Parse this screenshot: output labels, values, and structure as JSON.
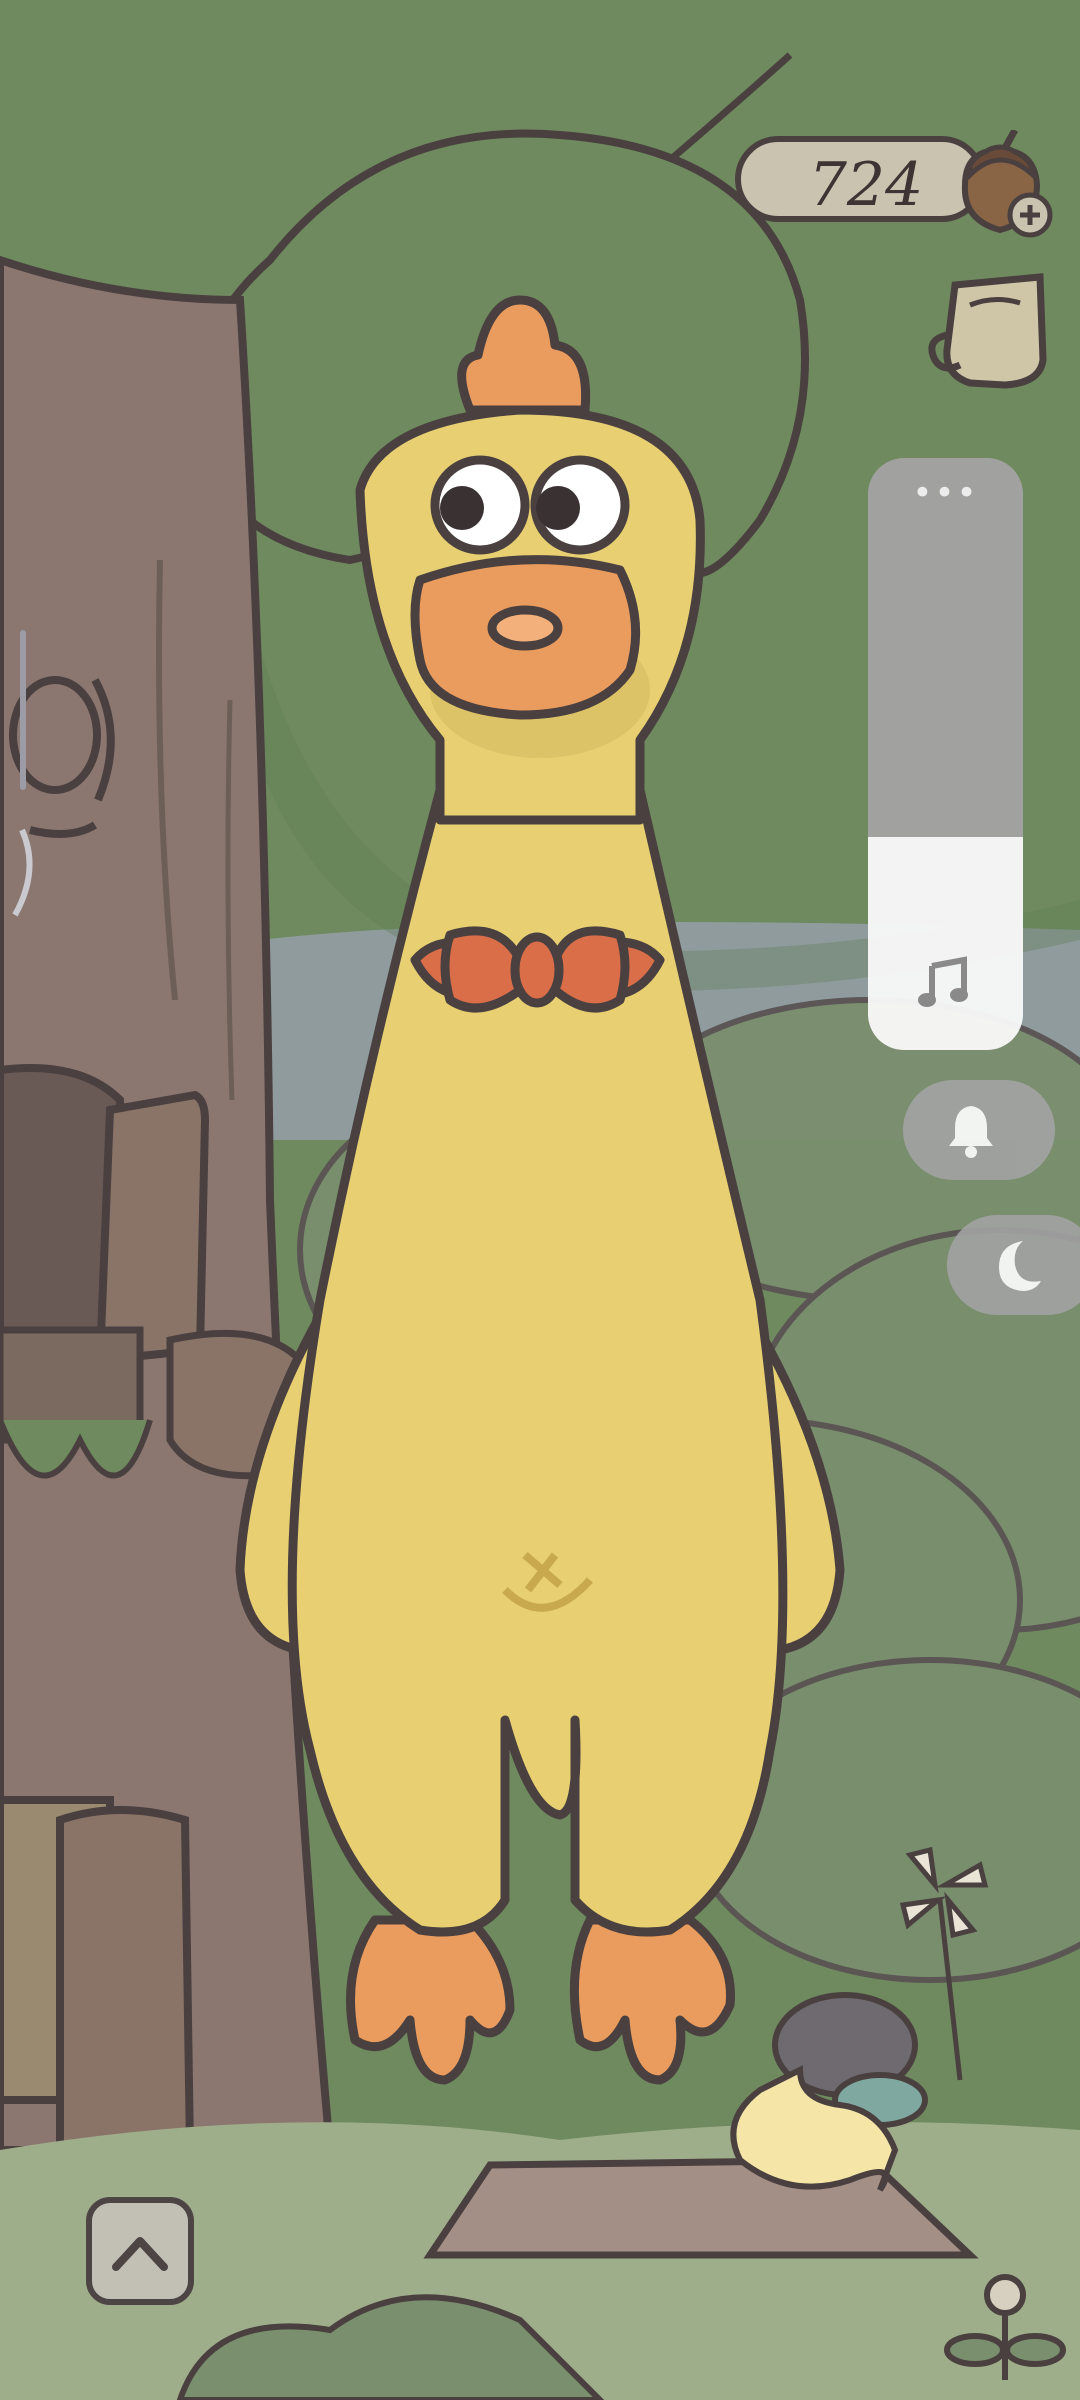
{
  "hud": {
    "acorn_count": "724"
  },
  "icons": {
    "acorn": "acorn-plus-icon",
    "cup": "cup-icon",
    "volume": "music-note-icon",
    "bell": "bell-icon",
    "moon": "moon-icon",
    "menu": "more-dots-icon",
    "scroll": "chevron-up-icon"
  },
  "volume_panel": {
    "dots": "•••",
    "level": 0.36
  },
  "colors": {
    "character_body": "#e7cf72",
    "character_beak": "#ea9c5e",
    "bow_tie": "#d96e49",
    "sky_green": "#6f8a5e",
    "panel_gray": "#a3a3a3"
  }
}
